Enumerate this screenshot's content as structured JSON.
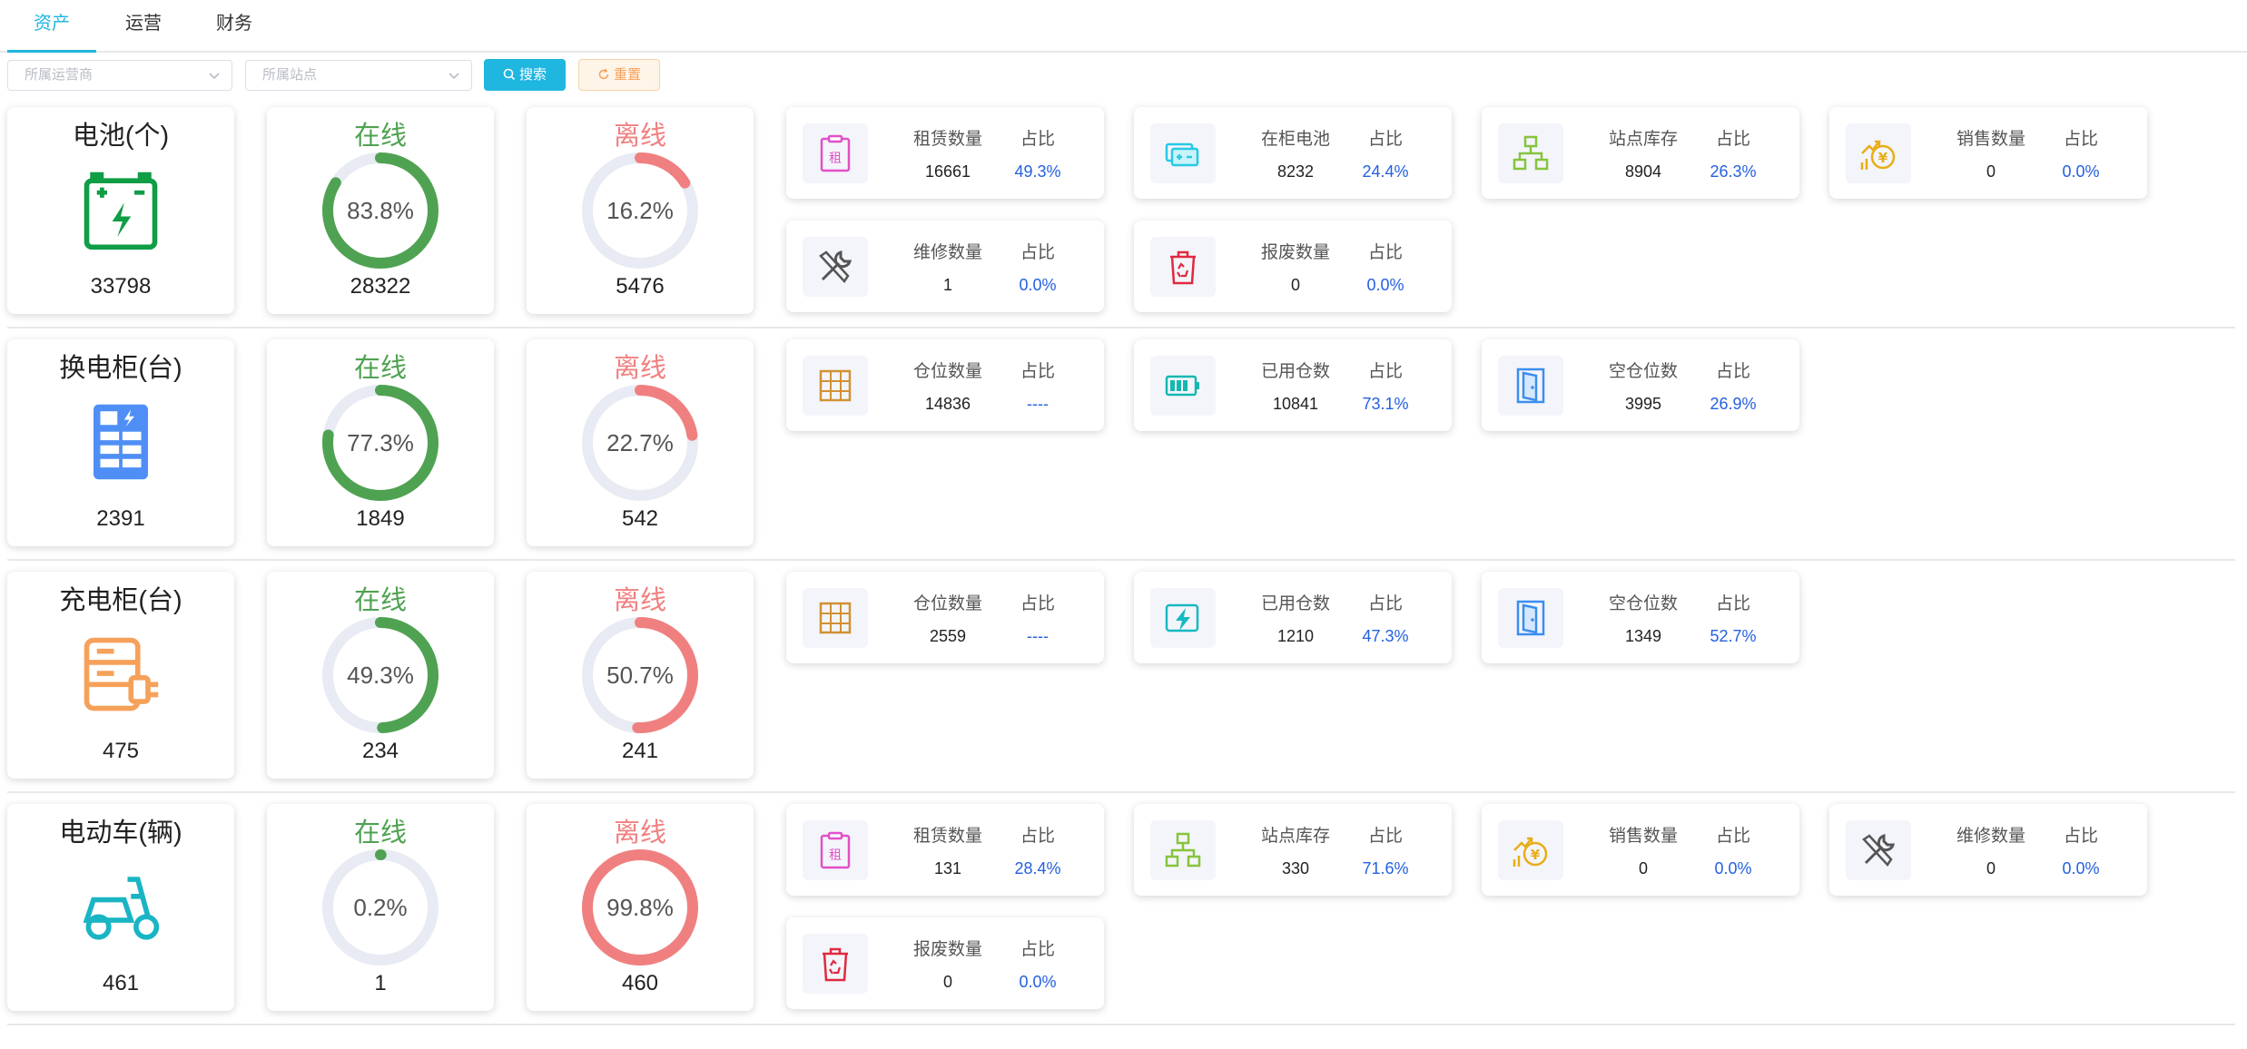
{
  "tabs": [
    {
      "label": "资产",
      "active": true
    },
    {
      "label": "运营",
      "active": false
    },
    {
      "label": "财务",
      "active": false
    }
  ],
  "filters": {
    "operator_placeholder": "所属运营商",
    "station_placeholder": "所属站点",
    "search_label": "搜索",
    "reset_label": "重置"
  },
  "colors": {
    "accent": "#1fb6e0",
    "online": "#4fa251",
    "offline": "#f08080",
    "ring_track": "#e8ebf3",
    "percent": "#2460e0"
  },
  "ratio_label": "占比",
  "sections": [
    {
      "title": "电池(个)",
      "icon": "battery-icon",
      "total": "33798",
      "online_label": "在线",
      "online_pct": "83.8%",
      "online_value": 83.8,
      "online_count": "28322",
      "offline_label": "离线",
      "offline_pct": "16.2%",
      "offline_value": 16.2,
      "offline_count": "5476",
      "stats": [
        {
          "icon": "rent-clipboard-icon",
          "label": "租赁数量",
          "value": "16661",
          "ratio": "49.3%"
        },
        {
          "icon": "cabinet-battery-icon",
          "label": "在柜电池",
          "value": "8232",
          "ratio": "24.4%"
        },
        {
          "icon": "station-inventory-icon",
          "label": "站点库存",
          "value": "8904",
          "ratio": "26.3%"
        },
        {
          "icon": "sales-yuan-icon",
          "label": "销售数量",
          "value": "0",
          "ratio": "0.0%"
        },
        {
          "icon": "repair-tools-icon",
          "label": "维修数量",
          "value": "1",
          "ratio": "0.0%"
        },
        {
          "icon": "scrap-bin-icon",
          "label": "报废数量",
          "value": "0",
          "ratio": "0.0%"
        }
      ]
    },
    {
      "title": "换电柜(台)",
      "icon": "swap-cabinet-icon",
      "total": "2391",
      "online_label": "在线",
      "online_pct": "77.3%",
      "online_value": 77.3,
      "online_count": "1849",
      "offline_label": "离线",
      "offline_pct": "22.7%",
      "offline_value": 22.7,
      "offline_count": "542",
      "stats": [
        {
          "icon": "slot-grid-icon",
          "label": "仓位数量",
          "value": "14836",
          "ratio": "----"
        },
        {
          "icon": "battery-level-icon",
          "label": "已用仓数",
          "value": "10841",
          "ratio": "73.1%"
        },
        {
          "icon": "empty-door-icon",
          "label": "空仓位数",
          "value": "3995",
          "ratio": "26.9%"
        }
      ]
    },
    {
      "title": "充电柜(台)",
      "icon": "charging-cabinet-icon",
      "total": "475",
      "online_label": "在线",
      "online_pct": "49.3%",
      "online_value": 49.3,
      "online_count": "234",
      "offline_label": "离线",
      "offline_pct": "50.7%",
      "offline_value": 50.7,
      "offline_count": "241",
      "stats": [
        {
          "icon": "slot-grid-icon",
          "label": "仓位数量",
          "value": "2559",
          "ratio": "----"
        },
        {
          "icon": "lightning-charge-icon",
          "label": "已用仓数",
          "value": "1210",
          "ratio": "47.3%"
        },
        {
          "icon": "empty-door-icon",
          "label": "空仓位数",
          "value": "1349",
          "ratio": "52.7%"
        }
      ]
    },
    {
      "title": "电动车(辆)",
      "icon": "scooter-icon",
      "total": "461",
      "online_label": "在线",
      "online_pct": "0.2%",
      "online_value": 0.2,
      "online_count": "1",
      "offline_label": "离线",
      "offline_pct": "99.8%",
      "offline_value": 99.8,
      "offline_count": "460",
      "stats": [
        {
          "icon": "rent-clipboard-icon",
          "label": "租赁数量",
          "value": "131",
          "ratio": "28.4%"
        },
        {
          "icon": "station-inventory-icon",
          "label": "站点库存",
          "value": "330",
          "ratio": "71.6%"
        },
        {
          "icon": "sales-yuan-icon",
          "label": "销售数量",
          "value": "0",
          "ratio": "0.0%"
        },
        {
          "icon": "repair-tools-icon",
          "label": "维修数量",
          "value": "0",
          "ratio": "0.0%"
        },
        {
          "icon": "scrap-bin-icon",
          "label": "报废数量",
          "value": "0",
          "ratio": "0.0%"
        }
      ]
    }
  ]
}
